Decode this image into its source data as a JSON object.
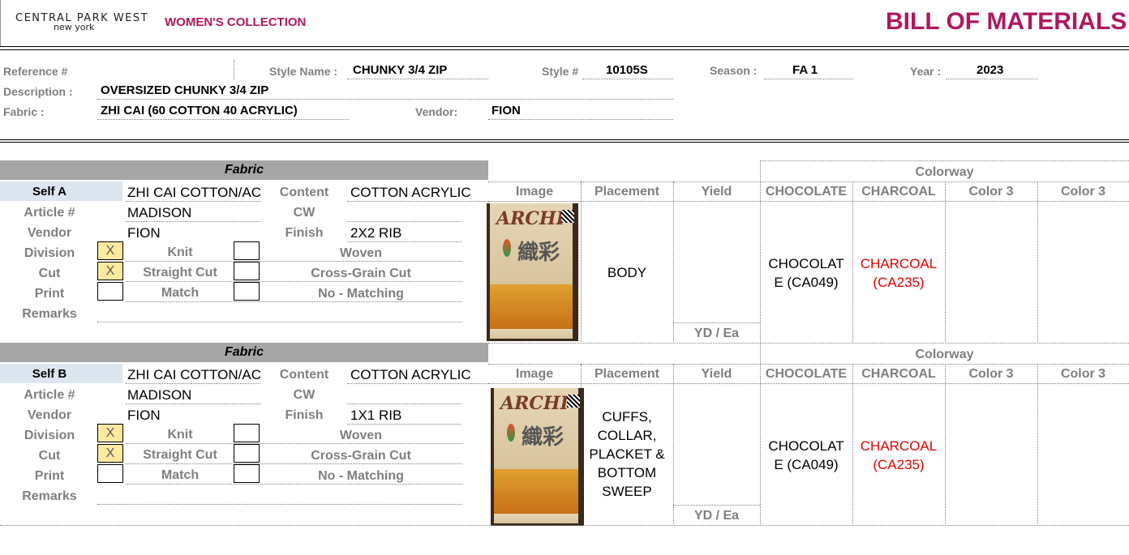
{
  "header": {
    "brand_line1": "CENTRAL PARK WEST",
    "brand_line2": "new york",
    "collection": "WOMEN'S COLLECTION",
    "title": "BILL OF MATERIALS"
  },
  "info": {
    "reference_label": "Reference #",
    "reference_value": "",
    "style_name_label": "Style Name :",
    "style_name_value": "CHUNKY 3/4 ZIP",
    "style_no_label": "Style #",
    "style_no_value": "10105S",
    "season_label": "Season :",
    "season_value": "FA 1",
    "year_label": "Year :",
    "year_value": "2023",
    "description_label": "Description :",
    "description_value": "OVERSIZED CHUNKY 3/4 ZIP",
    "fabric_label": "Fabric :",
    "fabric_value": "ZHI CAI (60 COTTON 40 ACRYLIC)",
    "vendor_label": "Vendor:",
    "vendor_value": "FION"
  },
  "labels": {
    "fabric_banner": "Fabric",
    "colorway_banner": "Colorway",
    "article": "Article #",
    "vendor": "Vendor",
    "division": "Division",
    "cut": "Cut",
    "print": "Print",
    "remarks": "Remarks",
    "content": "Content",
    "cw": "CW",
    "finish": "Finish",
    "knit": "Knit",
    "woven": "Woven",
    "straight_cut": "Straight Cut",
    "cross_grain_cut": "Cross-Grain Cut",
    "match": "Match",
    "no_matching": "No - Matching",
    "image": "Image",
    "placement": "Placement",
    "yield": "Yield",
    "yield_unit": "YD / Ea",
    "mark": "X"
  },
  "colorway_headers": [
    "CHOCOLATE",
    "CHARCOAL",
    "Color 3",
    "Color 3"
  ],
  "sections": [
    {
      "self_label": "Self A",
      "fabric_name": "ZHI CAI COTTON/AC",
      "content": "COTTON ACRYLIC",
      "article": "MADISON",
      "cw": "",
      "vendor": "FION",
      "finish": "2X2 RIB",
      "division_knit_checked": true,
      "cut_straight_checked": true,
      "placement": [
        "BODY"
      ],
      "yield": "",
      "colors": {
        "chocolate": [
          "CHOCOLAT",
          "E (CA049)"
        ],
        "charcoal": [
          "CHARCOAL",
          "(CA235)"
        ]
      }
    },
    {
      "self_label": "Self B",
      "fabric_name": "ZHI CAI COTTON/AC",
      "content": "COTTON ACRYLIC",
      "article": "MADISON",
      "cw": "",
      "vendor": "FION",
      "finish": "1X1 RIB",
      "division_knit_checked": true,
      "cut_straight_checked": true,
      "placement": [
        "CUFFS,",
        "COLLAR,",
        "PLACKET &",
        "BOTTOM",
        "SWEEP"
      ],
      "yield": "",
      "colors": {
        "chocolate": [
          "CHOCOLAT",
          "E (CA049)"
        ],
        "charcoal": [
          "CHARCOAL",
          "(CA235)"
        ]
      }
    }
  ],
  "swatch": {
    "logo_text": "ARCHI",
    "glyph_text": "織彩"
  }
}
